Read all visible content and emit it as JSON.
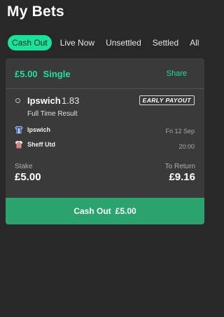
{
  "page": {
    "title": "My Bets"
  },
  "tabs": [
    "Cash Out",
    "Live Now",
    "Unsettled",
    "Settled",
    "All"
  ],
  "bet": {
    "stake_header": "£5.00",
    "type": "Single",
    "share_label": "Share",
    "selection": "Ipswich",
    "odds": "1.83",
    "badge": "EARLY PAYOUT",
    "market": "Full Time Result",
    "home_team": "Ipswich",
    "away_team": "Sheff Utd",
    "date": "Fri 12 Sep",
    "time": "20:00",
    "stake_label": "Stake",
    "stake_value": "£5.00",
    "return_label": "To Return",
    "return_value": "£9.16",
    "cashout_label": "Cash Out",
    "cashout_amount": "£5.00"
  },
  "colors": {
    "background": "#282828",
    "card": "#3a3a3a",
    "accent": "#19e39a",
    "cashout_button": "#2aa36f"
  }
}
